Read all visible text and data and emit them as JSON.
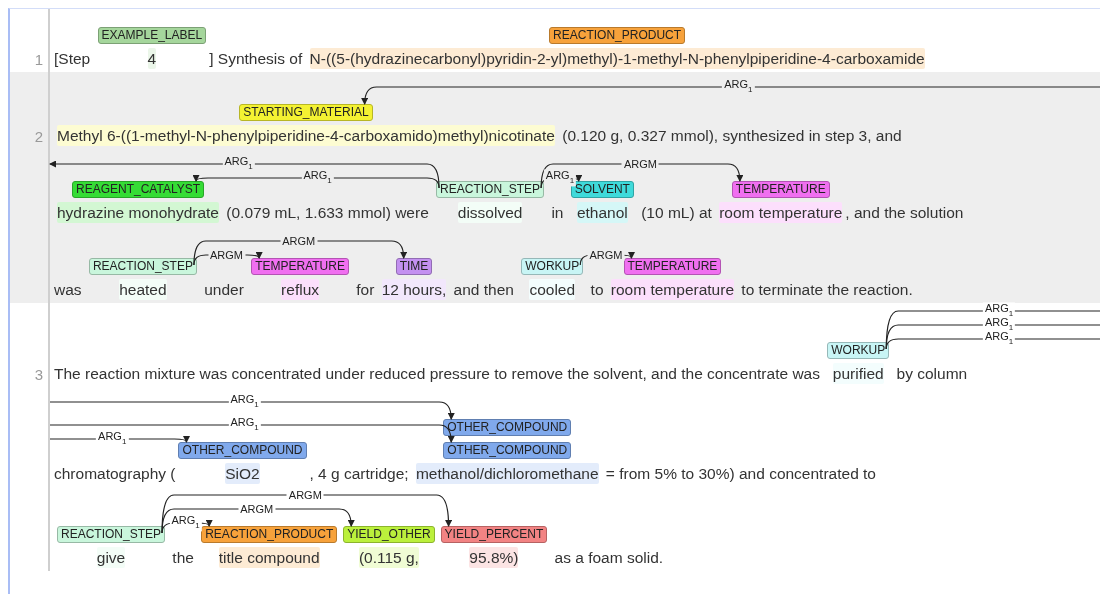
{
  "sentences": [
    {
      "number": "1",
      "rows": [
        {
          "tokens": [
            {
              "text": "[Step "
            },
            {
              "text": "4",
              "labels": [
                {
                  "name": "EXAMPLE_LABEL",
                  "color": "#a5d69c"
                }
              ]
            },
            {
              "text": "] Synthesis of "
            },
            {
              "text": "N-((5-(hydrazinecarbonyl)pyridin-2-yl)methyl)-1-methyl-N-phenylpiperidine-4-carboxamide",
              "labels": [
                {
                  "name": "REACTION_PRODUCT",
                  "color": "#f7a23b"
                }
              ]
            }
          ]
        }
      ]
    },
    {
      "number": "2",
      "rows": [
        {
          "tokens": [
            {
              "text": "Methyl 6-((1-methyl-N-phenylpiperidine-4-carboxamido)methyl)nicotinate",
              "labels": [
                {
                  "name": "STARTING_MATERIAL",
                  "color": "#f4f232"
                }
              ]
            },
            {
              "text": " (0.120 g, 0.327 mmol), synthesized in step 3, and"
            }
          ],
          "arcs": [
            {
              "label": "ARG$_{1}$"
            }
          ]
        },
        {
          "tokens": [
            {
              "text": "hydrazine monohydrate",
              "labels": [
                {
                  "name": "REAGENT_CATALYST",
                  "color": "#35dc35"
                }
              ]
            },
            {
              "text": " (0.079 mL, 1.633 mmol) were "
            },
            {
              "text": "dissolved",
              "labels": [
                {
                  "name": "REACTION_STEP",
                  "color": "#c9f6dc"
                }
              ]
            },
            {
              "text": " in "
            },
            {
              "text": "ethanol",
              "labels": [
                {
                  "name": "SOLVENT",
                  "color": "#3fdada"
                }
              ]
            },
            {
              "text": " (10 mL) at "
            },
            {
              "text": "room temperature",
              "labels": [
                {
                  "name": "TEMPERATURE",
                  "color": "#f06ff0"
                }
              ]
            },
            {
              "text": ", and the solution"
            }
          ],
          "arcs": [
            {
              "label": "ARG$_{1}$"
            },
            {
              "label": "ARG$_{1}$"
            },
            {
              "label": "ARG$_{1}$"
            },
            {
              "label": "ARGM"
            }
          ]
        },
        {
          "tokens": [
            {
              "text": "was "
            },
            {
              "text": "heated",
              "labels": [
                {
                  "name": "REACTION_STEP",
                  "color": "#c9f6dc"
                }
              ]
            },
            {
              "text": " under "
            },
            {
              "text": "reflux",
              "labels": [
                {
                  "name": "TEMPERATURE",
                  "color": "#f06ff0"
                }
              ]
            },
            {
              "text": " for "
            },
            {
              "text": "12 hours,",
              "labels": [
                {
                  "name": "TIME",
                  "color": "#c390f0"
                }
              ]
            },
            {
              "text": " and then "
            },
            {
              "text": "cooled",
              "labels": [
                {
                  "name": "WORKUP",
                  "color": "#c8f5f5"
                }
              ]
            },
            {
              "text": " to "
            },
            {
              "text": "room temperature",
              "labels": [
                {
                  "name": "TEMPERATURE",
                  "color": "#f06ff0"
                }
              ]
            },
            {
              "text": " to terminate the reaction."
            }
          ],
          "arcs": [
            {
              "label": "ARGM"
            },
            {
              "label": "ARGM"
            },
            {
              "label": "ARGM"
            }
          ]
        }
      ]
    },
    {
      "number": "3",
      "rows": [
        {
          "tokens": [
            {
              "text": "The reaction mixture was concentrated under reduced pressure to remove the solvent, and the concentrate was "
            },
            {
              "text": "purified",
              "labels": [
                {
                  "name": "WORKUP",
                  "color": "#c8f5f5"
                }
              ]
            },
            {
              "text": " by column"
            }
          ],
          "arcs": [
            {
              "label": "ARG$_{1}$"
            },
            {
              "label": "ARG$_{1}$"
            },
            {
              "label": "ARG$_{1}$"
            }
          ]
        },
        {
          "tokens": [
            {
              "text": "chromatography ("
            },
            {
              "text": "SiO2",
              "labels": [
                {
                  "name": "OTHER_COMPOUND",
                  "color": "#80a9ec"
                }
              ]
            },
            {
              "text": ", 4 g cartridge; "
            },
            {
              "text": "methanol/dichloromethane",
              "labels": [
                {
                  "name": "OTHER_COMPOUND",
                  "color": "#80a9ec"
                },
                {
                  "name": "OTHER_COMPOUND",
                  "color": "#80a9ec"
                }
              ]
            },
            {
              "text": " = from 5% to 30%) and concentrated to"
            }
          ],
          "arcs": [
            {
              "label": "ARG$_{1}$"
            },
            {
              "label": "ARG$_{1}$"
            },
            {
              "label": "ARG$_{1}$"
            }
          ]
        },
        {
          "tokens": [
            {
              "text": "give",
              "labels": [
                {
                  "name": "REACTION_STEP",
                  "color": "#c9f6dc"
                }
              ]
            },
            {
              "text": " the "
            },
            {
              "text": "title compound",
              "labels": [
                {
                  "name": "REACTION_PRODUCT",
                  "color": "#f7a23b"
                }
              ]
            },
            {
              "text": "(0.115 g,",
              "labels": [
                {
                  "name": "YIELD_OTHER",
                  "color": "#bbf03c"
                }
              ]
            },
            {
              "text": "95.8%)",
              "labels": [
                {
                  "name": "YIELD_PERCENT",
                  "color": "#f28383"
                }
              ]
            },
            {
              "text": " as a foam solid."
            }
          ],
          "arcs": [
            {
              "label": "ARGM"
            },
            {
              "label": "ARGM"
            },
            {
              "label": "ARG$_{1}$"
            }
          ]
        }
      ]
    }
  ]
}
